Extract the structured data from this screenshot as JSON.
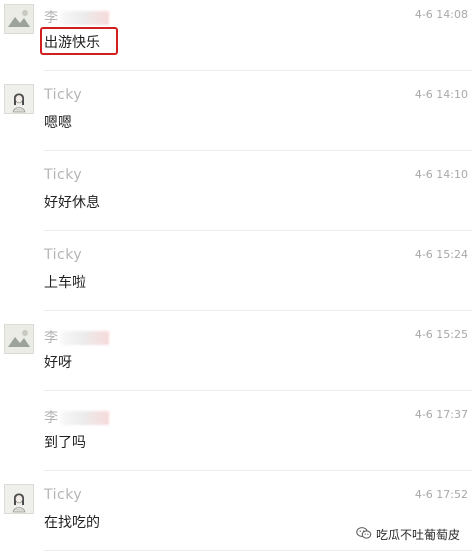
{
  "messages": [
    {
      "sender": "李",
      "redacted": true,
      "time": "4-6 14:08",
      "text": "出游快乐",
      "avatar": "landscape-avatar",
      "highlighted": true
    },
    {
      "sender": "Ticky",
      "redacted": false,
      "time": "4-6 14:10",
      "text": "嗯嗯",
      "avatar": "girl-sketch-avatar",
      "highlighted": false
    },
    {
      "sender": "Ticky",
      "redacted": false,
      "time": "4-6 14:10",
      "text": "好好休息",
      "avatar": "",
      "highlighted": false
    },
    {
      "sender": "Ticky",
      "redacted": false,
      "time": "4-6 15:24",
      "text": "上车啦",
      "avatar": "",
      "highlighted": false
    },
    {
      "sender": "李",
      "redacted": true,
      "time": "4-6 15:25",
      "text": "好呀",
      "avatar": "landscape-avatar",
      "highlighted": false
    },
    {
      "sender": "李",
      "redacted": true,
      "time": "4-6 17:37",
      "text": "到了吗",
      "avatar": "",
      "highlighted": false
    },
    {
      "sender": "Ticky",
      "redacted": false,
      "time": "4-6 17:52",
      "text": "在找吃的",
      "avatar": "girl-sketch-avatar",
      "highlighted": false
    }
  ],
  "watermark": {
    "icon": "wechat-official-account-icon",
    "text": "吃瓜不吐葡萄皮"
  },
  "colors": {
    "highlight": "#d11f1f",
    "meta_text": "#b5b5b5",
    "body_text": "#222222",
    "separator": "#ececec"
  }
}
